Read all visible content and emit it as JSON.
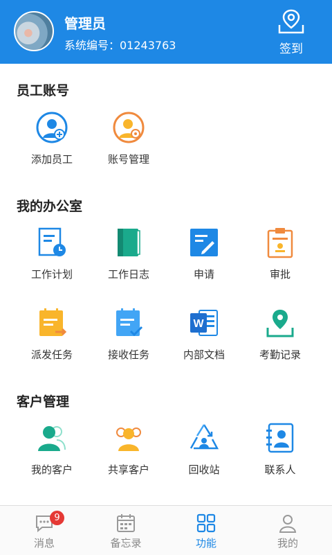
{
  "header": {
    "name": "管理员",
    "system_id": "系统编号：01243763",
    "checkin_label": "签到"
  },
  "sections": {
    "staff": {
      "title": "员工账号",
      "items": [
        {
          "label": "添加员工",
          "icon": "add-staff-icon"
        },
        {
          "label": "账号管理",
          "icon": "account-settings-icon"
        }
      ]
    },
    "office": {
      "title": "我的办公室",
      "items": [
        {
          "label": "工作计划",
          "icon": "work-plan-icon"
        },
        {
          "label": "工作日志",
          "icon": "work-log-icon"
        },
        {
          "label": "申请",
          "icon": "apply-icon"
        },
        {
          "label": "审批",
          "icon": "approve-icon"
        },
        {
          "label": "派发任务",
          "icon": "dispatch-task-icon"
        },
        {
          "label": "接收任务",
          "icon": "receive-task-icon"
        },
        {
          "label": "内部文档",
          "icon": "word-doc-icon"
        },
        {
          "label": "考勤记录",
          "icon": "attendance-icon"
        }
      ]
    },
    "customers": {
      "title": "客户管理",
      "items": [
        {
          "label": "我的客户",
          "icon": "my-customers-icon"
        },
        {
          "label": "共享客户",
          "icon": "shared-customers-icon"
        },
        {
          "label": "回收站",
          "icon": "recycle-bin-icon"
        },
        {
          "label": "联系人",
          "icon": "contacts-icon"
        }
      ]
    }
  },
  "tabbar": {
    "tabs": [
      {
        "label": "消息",
        "badge": "9"
      },
      {
        "label": "备忘录"
      },
      {
        "label": "功能",
        "active": true
      },
      {
        "label": "我的"
      }
    ]
  },
  "colors": {
    "primary": "#1e88e5",
    "badge": "#e53935",
    "green": "#1aaa8c",
    "orange": "#f08a3e",
    "yellow": "#f9b52b"
  }
}
